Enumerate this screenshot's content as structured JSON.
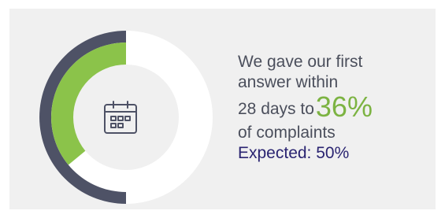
{
  "stat": {
    "line1": "We gave our first",
    "line2": "answer within",
    "line3_prefix": "28 days to",
    "percent_label": "36%",
    "line4": "of complaints",
    "expected": "Expected: 50%"
  },
  "icon": "calendar-icon",
  "colors": {
    "actual": "#8bc34a",
    "expected": "#4e5266",
    "track": "#ffffff",
    "center": "#f0f0f0",
    "percent_text": "#7cb342",
    "expected_text": "#2a2471",
    "body_text": "#4b4f5c"
  },
  "chart_data": {
    "type": "pie",
    "variant": "nested-donut",
    "series": [
      {
        "name": "",
        "value": 36
      },
      {
        "name": "",
        "value": 50
      }
    ],
    "max": 100
  }
}
